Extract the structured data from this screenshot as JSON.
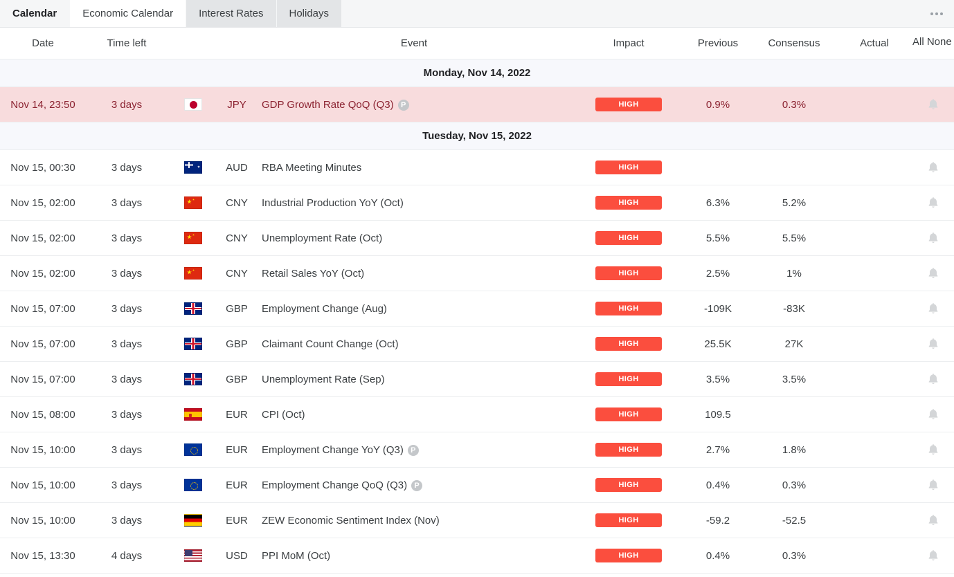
{
  "tabs": [
    {
      "label": "Calendar",
      "state": "first"
    },
    {
      "label": "Economic Calendar",
      "state": "active"
    },
    {
      "label": "Interest Rates",
      "state": "normal"
    },
    {
      "label": "Holidays",
      "state": "normal"
    }
  ],
  "overflow_menu": {
    "icon": "kebab-menu-icon"
  },
  "columns": {
    "date": "Date",
    "time_left": "Time left",
    "event": "Event",
    "impact": "Impact",
    "previous": "Previous",
    "consensus": "Consensus",
    "actual": "Actual",
    "alerts": "All None",
    "alerts_info_icon": "i"
  },
  "colors": {
    "impact_high": "#fb4e3e",
    "highlight_row_bg": "#f8dcdd",
    "highlight_row_text": "#8b2230",
    "day_separator_bg": "#f7f8fc",
    "active_tab_bg": "#ffffff",
    "tabbar_bg": "#f5f6f7"
  },
  "groups": [
    {
      "day_label": "Monday, Nov 14, 2022",
      "rows": [
        {
          "date": "Nov 14, 23:50",
          "time_left": "3 days",
          "flag": "jp",
          "flag_name": "flag-japan",
          "currency": "JPY",
          "event": "GDP Growth Rate QoQ (Q3)",
          "preliminary_badge": "P",
          "impact": "HIGH",
          "previous": "0.9%",
          "consensus": "0.3%",
          "actual": "",
          "alert_icon": "bell-icon",
          "highlighted": true
        }
      ]
    },
    {
      "day_label": "Tuesday, Nov 15, 2022",
      "rows": [
        {
          "date": "Nov 15, 00:30",
          "time_left": "3 days",
          "flag": "au",
          "flag_name": "flag-australia",
          "currency": "AUD",
          "event": "RBA Meeting Minutes",
          "preliminary_badge": "",
          "impact": "HIGH",
          "previous": "",
          "consensus": "",
          "actual": "",
          "alert_icon": "bell-icon",
          "highlighted": false
        },
        {
          "date": "Nov 15, 02:00",
          "time_left": "3 days",
          "flag": "cn",
          "flag_name": "flag-china",
          "currency": "CNY",
          "event": "Industrial Production YoY (Oct)",
          "preliminary_badge": "",
          "impact": "HIGH",
          "previous": "6.3%",
          "consensus": "5.2%",
          "actual": "",
          "alert_icon": "bell-icon",
          "highlighted": false
        },
        {
          "date": "Nov 15, 02:00",
          "time_left": "3 days",
          "flag": "cn",
          "flag_name": "flag-china",
          "currency": "CNY",
          "event": "Unemployment Rate (Oct)",
          "preliminary_badge": "",
          "impact": "HIGH",
          "previous": "5.5%",
          "consensus": "5.5%",
          "actual": "",
          "alert_icon": "bell-icon",
          "highlighted": false
        },
        {
          "date": "Nov 15, 02:00",
          "time_left": "3 days",
          "flag": "cn",
          "flag_name": "flag-china",
          "currency": "CNY",
          "event": "Retail Sales YoY (Oct)",
          "preliminary_badge": "",
          "impact": "HIGH",
          "previous": "2.5%",
          "consensus": "1%",
          "actual": "",
          "alert_icon": "bell-icon",
          "highlighted": false
        },
        {
          "date": "Nov 15, 07:00",
          "time_left": "3 days",
          "flag": "gb",
          "flag_name": "flag-united-kingdom",
          "currency": "GBP",
          "event": "Employment Change (Aug)",
          "preliminary_badge": "",
          "impact": "HIGH",
          "previous": "-109K",
          "consensus": "-83K",
          "actual": "",
          "alert_icon": "bell-icon",
          "highlighted": false
        },
        {
          "date": "Nov 15, 07:00",
          "time_left": "3 days",
          "flag": "gb",
          "flag_name": "flag-united-kingdom",
          "currency": "GBP",
          "event": "Claimant Count Change (Oct)",
          "preliminary_badge": "",
          "impact": "HIGH",
          "previous": "25.5K",
          "consensus": "27K",
          "actual": "",
          "alert_icon": "bell-icon",
          "highlighted": false
        },
        {
          "date": "Nov 15, 07:00",
          "time_left": "3 days",
          "flag": "gb",
          "flag_name": "flag-united-kingdom",
          "currency": "GBP",
          "event": "Unemployment Rate (Sep)",
          "preliminary_badge": "",
          "impact": "HIGH",
          "previous": "3.5%",
          "consensus": "3.5%",
          "actual": "",
          "alert_icon": "bell-icon",
          "highlighted": false
        },
        {
          "date": "Nov 15, 08:00",
          "time_left": "3 days",
          "flag": "es",
          "flag_name": "flag-spain",
          "currency": "EUR",
          "event": "CPI (Oct)",
          "preliminary_badge": "",
          "impact": "HIGH",
          "previous": "109.5",
          "consensus": "",
          "actual": "",
          "alert_icon": "bell-icon",
          "highlighted": false
        },
        {
          "date": "Nov 15, 10:00",
          "time_left": "3 days",
          "flag": "eu",
          "flag_name": "flag-european-union",
          "currency": "EUR",
          "event": "Employment Change YoY (Q3)",
          "preliminary_badge": "P",
          "impact": "HIGH",
          "previous": "2.7%",
          "consensus": "1.8%",
          "actual": "",
          "alert_icon": "bell-icon",
          "highlighted": false
        },
        {
          "date": "Nov 15, 10:00",
          "time_left": "3 days",
          "flag": "eu",
          "flag_name": "flag-european-union",
          "currency": "EUR",
          "event": "Employment Change QoQ (Q3)",
          "preliminary_badge": "P",
          "impact": "HIGH",
          "previous": "0.4%",
          "consensus": "0.3%",
          "actual": "",
          "alert_icon": "bell-icon",
          "highlighted": false
        },
        {
          "date": "Nov 15, 10:00",
          "time_left": "3 days",
          "flag": "de",
          "flag_name": "flag-germany",
          "currency": "EUR",
          "event": "ZEW Economic Sentiment Index (Nov)",
          "preliminary_badge": "",
          "impact": "HIGH",
          "previous": "-59.2",
          "consensus": "-52.5",
          "actual": "",
          "alert_icon": "bell-icon",
          "highlighted": false
        },
        {
          "date": "Nov 15, 13:30",
          "time_left": "4 days",
          "flag": "us",
          "flag_name": "flag-united-states",
          "currency": "USD",
          "event": "PPI MoM (Oct)",
          "preliminary_badge": "",
          "impact": "HIGH",
          "previous": "0.4%",
          "consensus": "0.3%",
          "actual": "",
          "alert_icon": "bell-icon",
          "highlighted": false
        }
      ]
    }
  ]
}
